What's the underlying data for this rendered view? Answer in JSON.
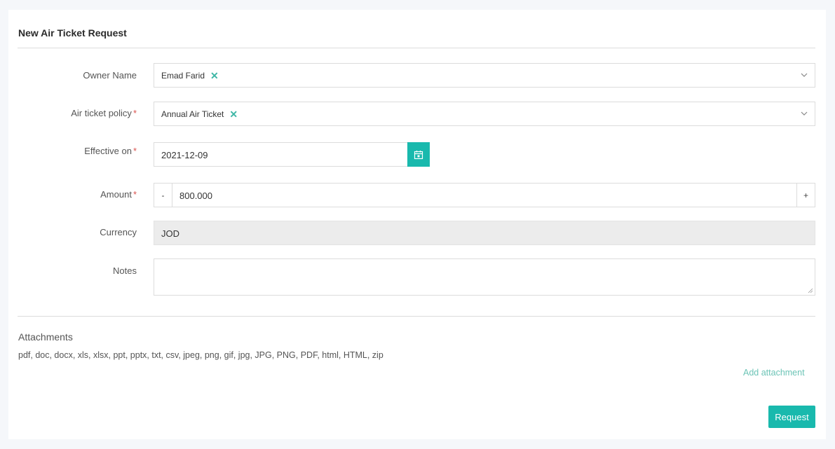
{
  "form": {
    "title": "New Air Ticket Request",
    "owner_name": {
      "label": "Owner Name",
      "value": "Emad Farid"
    },
    "policy": {
      "label": "Air ticket policy",
      "required_mark": "*",
      "value": "Annual Air Ticket"
    },
    "effective_on": {
      "label": "Effective on",
      "required_mark": "*",
      "value": "2021-12-09"
    },
    "amount": {
      "label": "Amount",
      "required_mark": "*",
      "value": "800.000",
      "minus": "-",
      "plus": "+"
    },
    "currency": {
      "label": "Currency",
      "value": "JOD"
    },
    "notes": {
      "label": "Notes",
      "value": ""
    }
  },
  "attachments": {
    "title": "Attachments",
    "allowed_types": "pdf, doc, docx, xls, xlsx, ppt, pptx, txt, csv, jpeg, png, gif, jpg, JPG, PNG, PDF, html, HTML, zip",
    "add_label": "Add attachment"
  },
  "actions": {
    "submit_label": "Request"
  },
  "colors": {
    "accent": "#19b9ad",
    "required": "#d9534f",
    "remove_x": "#3fb7a6"
  },
  "icons": {
    "remove": "close-icon",
    "dropdown": "chevron-down-icon",
    "calendar": "calendar-icon"
  }
}
